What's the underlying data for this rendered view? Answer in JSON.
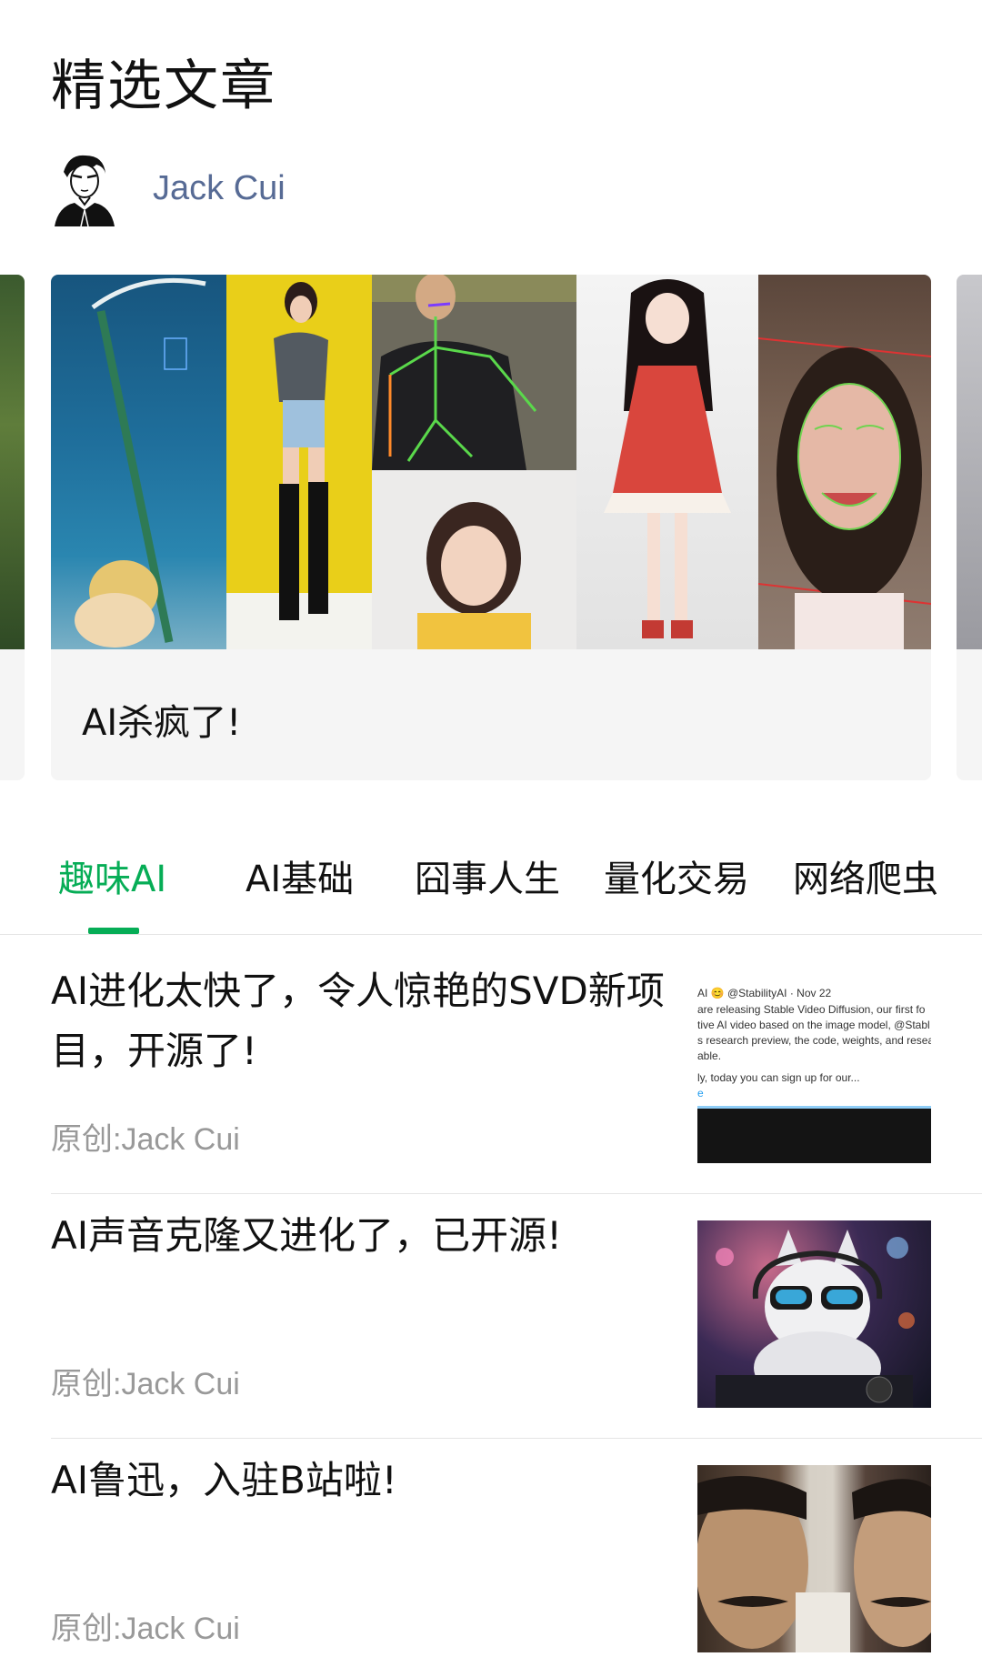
{
  "header": {
    "title": "精选文章"
  },
  "author": {
    "name": "Jack Cui",
    "avatar_icon": "author-avatar-icon"
  },
  "carousel": {
    "featured": {
      "caption": "AI杀疯了!"
    }
  },
  "tabs": [
    {
      "label": "趣味AI",
      "active": true
    },
    {
      "label": "AI基础",
      "active": false
    },
    {
      "label": "囧事人生",
      "active": false
    },
    {
      "label": "量化交易",
      "active": false
    },
    {
      "label": "网络爬虫",
      "active": false
    }
  ],
  "articles": [
    {
      "title": "AI进化太快了，令人惊艳的SVD新项目，开源了!",
      "meta": "原创:Jack Cui",
      "thumb_text": [
        "AI 😊 @StabilityAI · Nov 22",
        "are releasing Stable Video Diffusion, our first fo",
        "tive AI video based on the image model, @Stabl",
        "s research preview, the code, weights, and resea",
        "able.",
        "ly, today you can sign up for our...",
        "e"
      ]
    },
    {
      "title": "AI声音克隆又进化了，已开源!",
      "meta": "原创:Jack Cui"
    },
    {
      "title": "AI鲁迅，入驻B站啦!",
      "meta": "原创:Jack Cui"
    }
  ],
  "colors": {
    "accent": "#06ad56",
    "author_link": "#576b95",
    "meta_gray": "#999999",
    "card_bg": "#f5f5f5"
  }
}
